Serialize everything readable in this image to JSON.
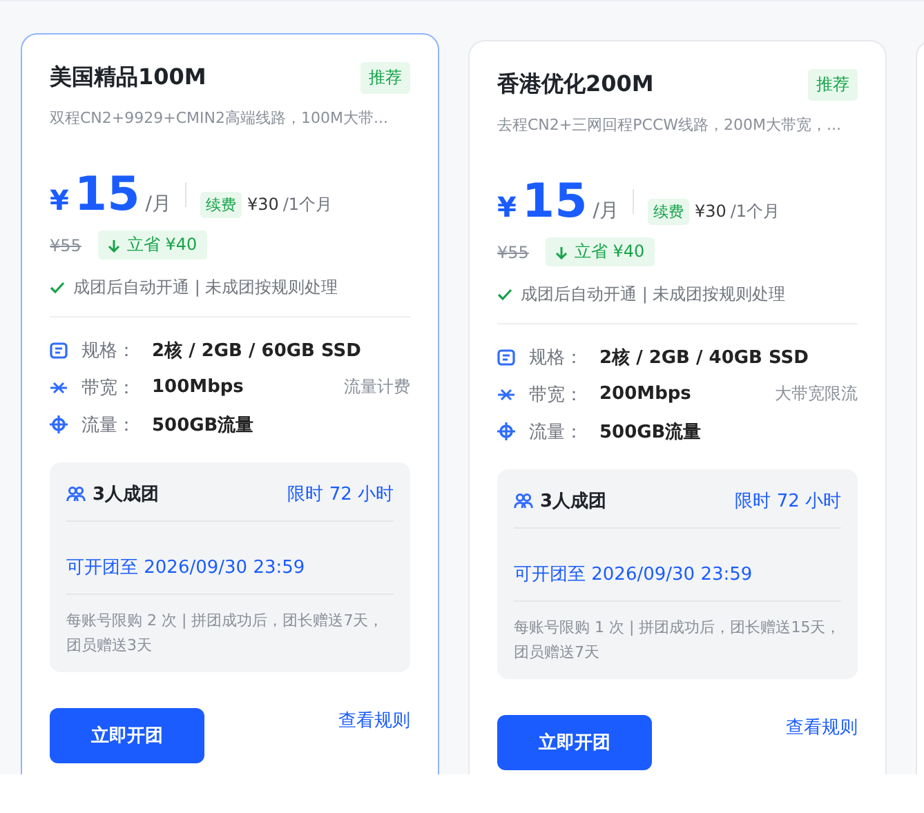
{
  "cards": [
    {
      "selected": true,
      "title": "美国精品100M",
      "badge": "推荐",
      "description": "双程CN2+9929+CMIN2高端线路，100M大带...",
      "currency": "¥",
      "amount": "15",
      "unit": "/月",
      "renew_label": "续费",
      "renew_price": "¥30",
      "renew_period": "/1个月",
      "original_price": "¥55",
      "saving": "立省 ¥40",
      "guarantee": "成团后自动开通 | 未成团按规则处理",
      "specs": [
        {
          "kind": "spec",
          "label": "规格：",
          "value": "2核 / 2GB / 60GB SSD"
        },
        {
          "kind": "bandwidth",
          "label": "带宽：",
          "value": "100Mbps",
          "note": "流量计费"
        },
        {
          "kind": "traffic",
          "label": "流量：",
          "value": "500GB流量"
        }
      ],
      "group": {
        "size": "3人成团",
        "limit": "限时 72 小时",
        "deadline": "可开团至 2026/09/30 23:59",
        "rules": "每账号限购 2 次 | 拼团成功后，团长赠送7天，团员赠送3天"
      },
      "button": "立即开团",
      "link": "查看规则"
    },
    {
      "selected": false,
      "title": "香港优化200M",
      "badge": "推荐",
      "description": "去程CN2+三网回程PCCW线路，200M大带宽，...",
      "currency": "¥",
      "amount": "15",
      "unit": "/月",
      "renew_label": "续费",
      "renew_price": "¥30",
      "renew_period": "/1个月",
      "original_price": "¥55",
      "saving": "立省 ¥40",
      "guarantee": "成团后自动开通 | 未成团按规则处理",
      "specs": [
        {
          "kind": "spec",
          "label": "规格：",
          "value": "2核 / 2GB / 40GB SSD"
        },
        {
          "kind": "bandwidth",
          "label": "带宽：",
          "value": "200Mbps",
          "note": "大带宽限流"
        },
        {
          "kind": "traffic",
          "label": "流量：",
          "value": "500GB流量"
        }
      ],
      "group": {
        "size": "3人成团",
        "limit": "限时 72 小时",
        "deadline": "可开团至 2026/09/30 23:59",
        "rules": "每账号限购 1 次 | 拼团成功后，团长赠送15天，团员赠送7天"
      },
      "button": "立即开团",
      "link": "查看规则"
    }
  ]
}
